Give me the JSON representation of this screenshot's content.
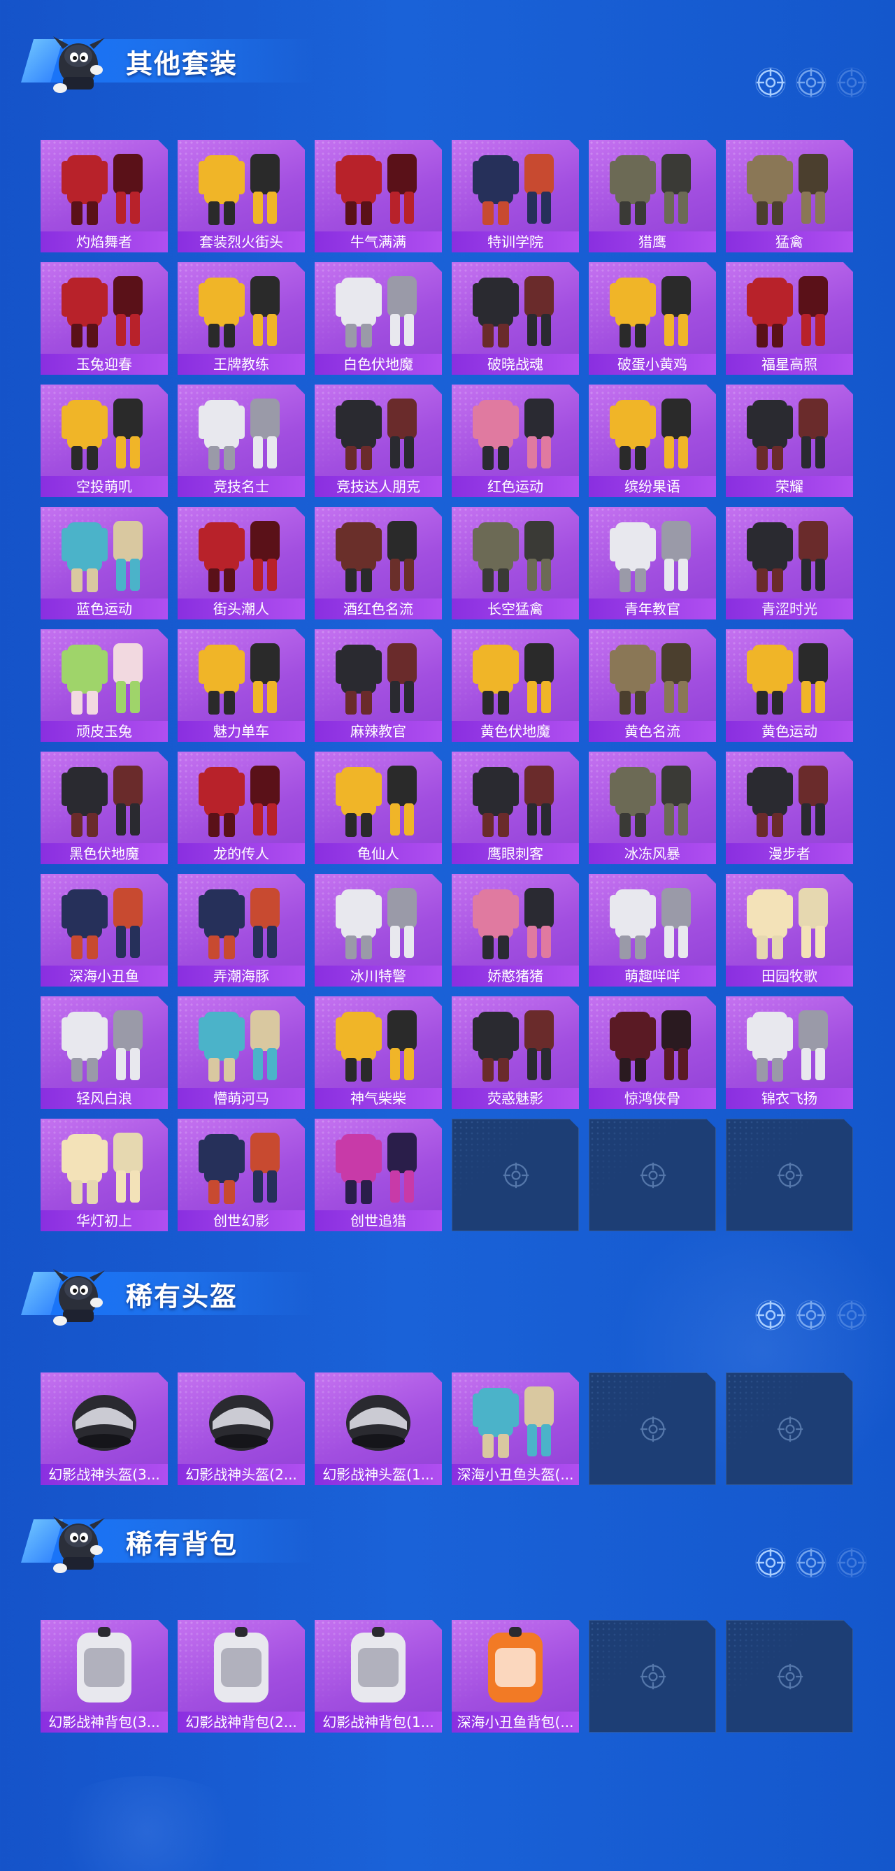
{
  "colors": {
    "background": "#1a62d8",
    "card_purple": "#a24fe0",
    "label_purple": "#8a2fe0",
    "empty_slot": "#1d3e75",
    "title_text": "#ffffff"
  },
  "sections": [
    {
      "id": "suits",
      "title": "其他套装",
      "icon": "crosshair-icon",
      "items": [
        {
          "label": "灼焰舞者",
          "palette": "red"
        },
        {
          "label": "套装烈火街头",
          "palette": "yellow"
        },
        {
          "label": "牛气满满",
          "palette": "red"
        },
        {
          "label": "特训学院",
          "palette": "navy"
        },
        {
          "label": "猎鹰",
          "palette": "camo"
        },
        {
          "label": "猛禽",
          "palette": "tan"
        },
        {
          "label": "玉兔迎春",
          "palette": "red"
        },
        {
          "label": "王牌教练",
          "palette": "yellow"
        },
        {
          "label": "白色伏地魔",
          "palette": "white"
        },
        {
          "label": "破晓战魂",
          "palette": "black"
        },
        {
          "label": "破蛋小黄鸡",
          "palette": "yellow"
        },
        {
          "label": "福星高照",
          "palette": "red"
        },
        {
          "label": "空投萌叽",
          "palette": "yellow"
        },
        {
          "label": "竞技名士",
          "palette": "white"
        },
        {
          "label": "竞技达人朋克",
          "palette": "black"
        },
        {
          "label": "红色运动",
          "palette": "pink"
        },
        {
          "label": "缤纷果语",
          "palette": "yellow"
        },
        {
          "label": "荣耀",
          "palette": "black"
        },
        {
          "label": "蓝色运动",
          "palette": "teal"
        },
        {
          "label": "街头潮人",
          "palette": "red"
        },
        {
          "label": "酒红色名流",
          "palette": "brown"
        },
        {
          "label": "长空猛禽",
          "palette": "camo"
        },
        {
          "label": "青年教官",
          "palette": "white"
        },
        {
          "label": "青涩时光",
          "palette": "black"
        },
        {
          "label": "顽皮玉兔",
          "palette": "green"
        },
        {
          "label": "魅力单车",
          "palette": "yellow"
        },
        {
          "label": "麻辣教官",
          "palette": "black"
        },
        {
          "label": "黄色伏地魔",
          "palette": "yellow"
        },
        {
          "label": "黄色名流",
          "palette": "tan"
        },
        {
          "label": "黄色运动",
          "palette": "yellow"
        },
        {
          "label": "黑色伏地魔",
          "palette": "black"
        },
        {
          "label": "龙的传人",
          "palette": "red"
        },
        {
          "label": "龟仙人",
          "palette": "yellow"
        },
        {
          "label": "鹰眼刺客",
          "palette": "black"
        },
        {
          "label": "冰冻风暴",
          "palette": "camo"
        },
        {
          "label": "漫步者",
          "palette": "black"
        },
        {
          "label": "深海小丑鱼",
          "palette": "navy"
        },
        {
          "label": "弄潮海豚",
          "palette": "navy"
        },
        {
          "label": "冰川特警",
          "palette": "white"
        },
        {
          "label": "娇憨猪猪",
          "palette": "pink"
        },
        {
          "label": "萌趣咩咩",
          "palette": "white"
        },
        {
          "label": "田园牧歌",
          "palette": "cream"
        },
        {
          "label": "轻风白浪",
          "palette": "white"
        },
        {
          "label": "懵萌河马",
          "palette": "teal"
        },
        {
          "label": "神气柴柴",
          "palette": "yellow"
        },
        {
          "label": "荧惑魅影",
          "palette": "black"
        },
        {
          "label": "惊鸿侠骨",
          "palette": "darkred"
        },
        {
          "label": "锦衣飞扬",
          "palette": "white"
        },
        {
          "label": "华灯初上",
          "palette": "cream"
        },
        {
          "label": "创世幻影",
          "palette": "navy"
        },
        {
          "label": "创世追猎",
          "palette": "magenta"
        },
        {
          "label": "",
          "palette": "empty"
        },
        {
          "label": "",
          "palette": "empty"
        },
        {
          "label": "",
          "palette": "empty"
        }
      ]
    },
    {
      "id": "helmets",
      "title": "稀有头盔",
      "icon": "crosshair-icon",
      "items": [
        {
          "label": "幻影战神头盔(3...",
          "palette": "helmet"
        },
        {
          "label": "幻影战神头盔(2...",
          "palette": "helmet"
        },
        {
          "label": "幻影战神头盔(1...",
          "palette": "helmet"
        },
        {
          "label": "深海小丑鱼头盔(...",
          "palette": "teal"
        },
        {
          "label": "",
          "palette": "empty"
        },
        {
          "label": "",
          "palette": "empty"
        }
      ]
    },
    {
      "id": "backpacks",
      "title": "稀有背包",
      "icon": "crosshair-icon",
      "items": [
        {
          "label": "幻影战神背包(3...",
          "palette": "white"
        },
        {
          "label": "幻影战神背包(2...",
          "palette": "white"
        },
        {
          "label": "幻影战神背包(1...",
          "palette": "white"
        },
        {
          "label": "深海小丑鱼背包(...",
          "palette": "orange"
        },
        {
          "label": "",
          "palette": "empty"
        },
        {
          "label": "",
          "palette": "empty"
        }
      ]
    }
  ]
}
